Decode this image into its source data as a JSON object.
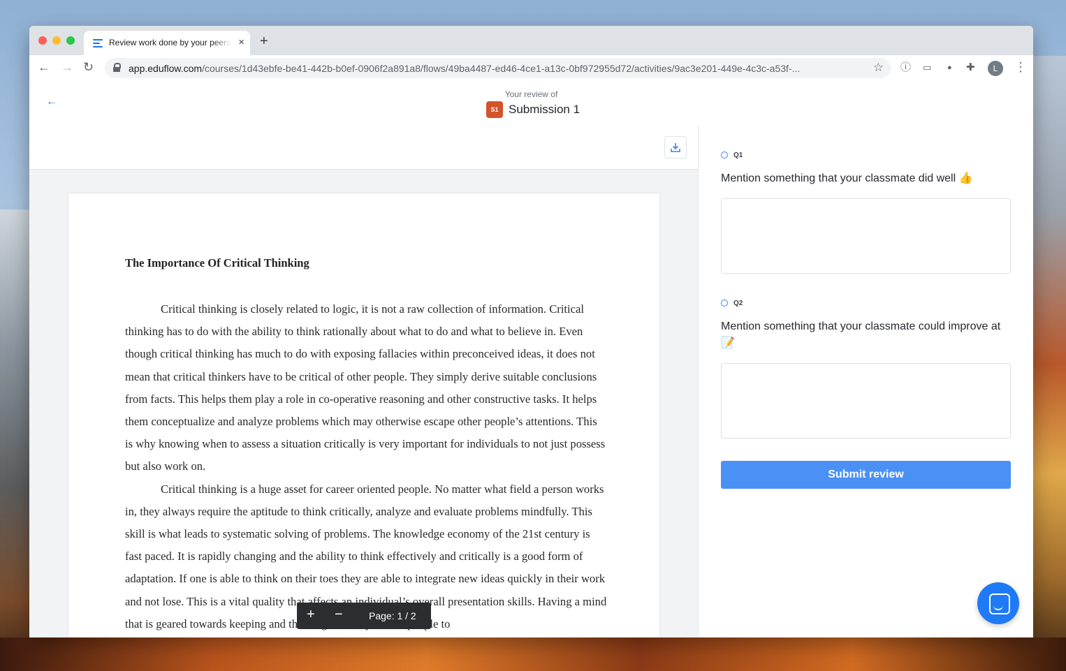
{
  "browser": {
    "tab_title": "Review work done by your peers",
    "tab_close": "×",
    "new_tab": "+",
    "url_host": "app.eduflow.com",
    "url_path": "/courses/1d43ebfe-be41-442b-b0ef-0906f2a891a8/flows/49ba4487-ed46-4ce1-a13c-0bf972955d72/activities/9ac3e201-449e-4c3c-a53f-...",
    "back": "←",
    "forward": "→",
    "reload": "↻",
    "star": "☆",
    "avatar_letter": "L",
    "menu": "⋮"
  },
  "header": {
    "back_arrow": "←",
    "review_of": "Your review of",
    "badge": "S1",
    "submission": "Submission 1"
  },
  "document": {
    "title": "The Importance Of Critical Thinking",
    "paragraphs": [
      "Critical thinking is closely related to logic, it is not a raw collection of information. Critical thinking has to do with the ability to think rationally about what to do and what to believe in. Even though critical thinking has much to do with exposing fallacies within preconceived ideas, it does not mean that critical thinkers have to be critical of other people. They simply derive suitable conclusions from facts. This helps them play a role in co-operative reasoning and other constructive tasks. It helps them conceptualize and analyze problems which may otherwise escape other people’s attentions. This is why knowing when to assess a situation critically is very important for individuals to not just possess but also work on.",
      "Critical thinking is a huge asset for career oriented people. No matter what field a person works in, they always require the aptitude to think critically, analyze and evaluate problems mindfully. This skill is what leads to systematic solving of problems. The knowledge economy of the 21st century is fast paced. It is rapidly changing and the ability to think effectively and critically is a good form of adaptation. If one is able to think on their toes they are able to integrate new ideas quickly in their work and not lose. This is a vital quality that affects an individual’s overall presentation skills. Having a mind that is geared towards keeping and thinking critically allows people to"
    ],
    "zoom_in": "+",
    "zoom_out": "−",
    "page_indicator": "Page: 1 / 2"
  },
  "form": {
    "q1_label": "Q1",
    "q1_text": "Mention something that your classmate did well 👍",
    "q2_label": "Q2",
    "q2_text": "Mention something that your classmate could improve at 📝",
    "submit": "Submit review"
  },
  "colors": {
    "accent": "#4a90f5",
    "badge": "#d2532c",
    "chat": "#1f7af5"
  }
}
